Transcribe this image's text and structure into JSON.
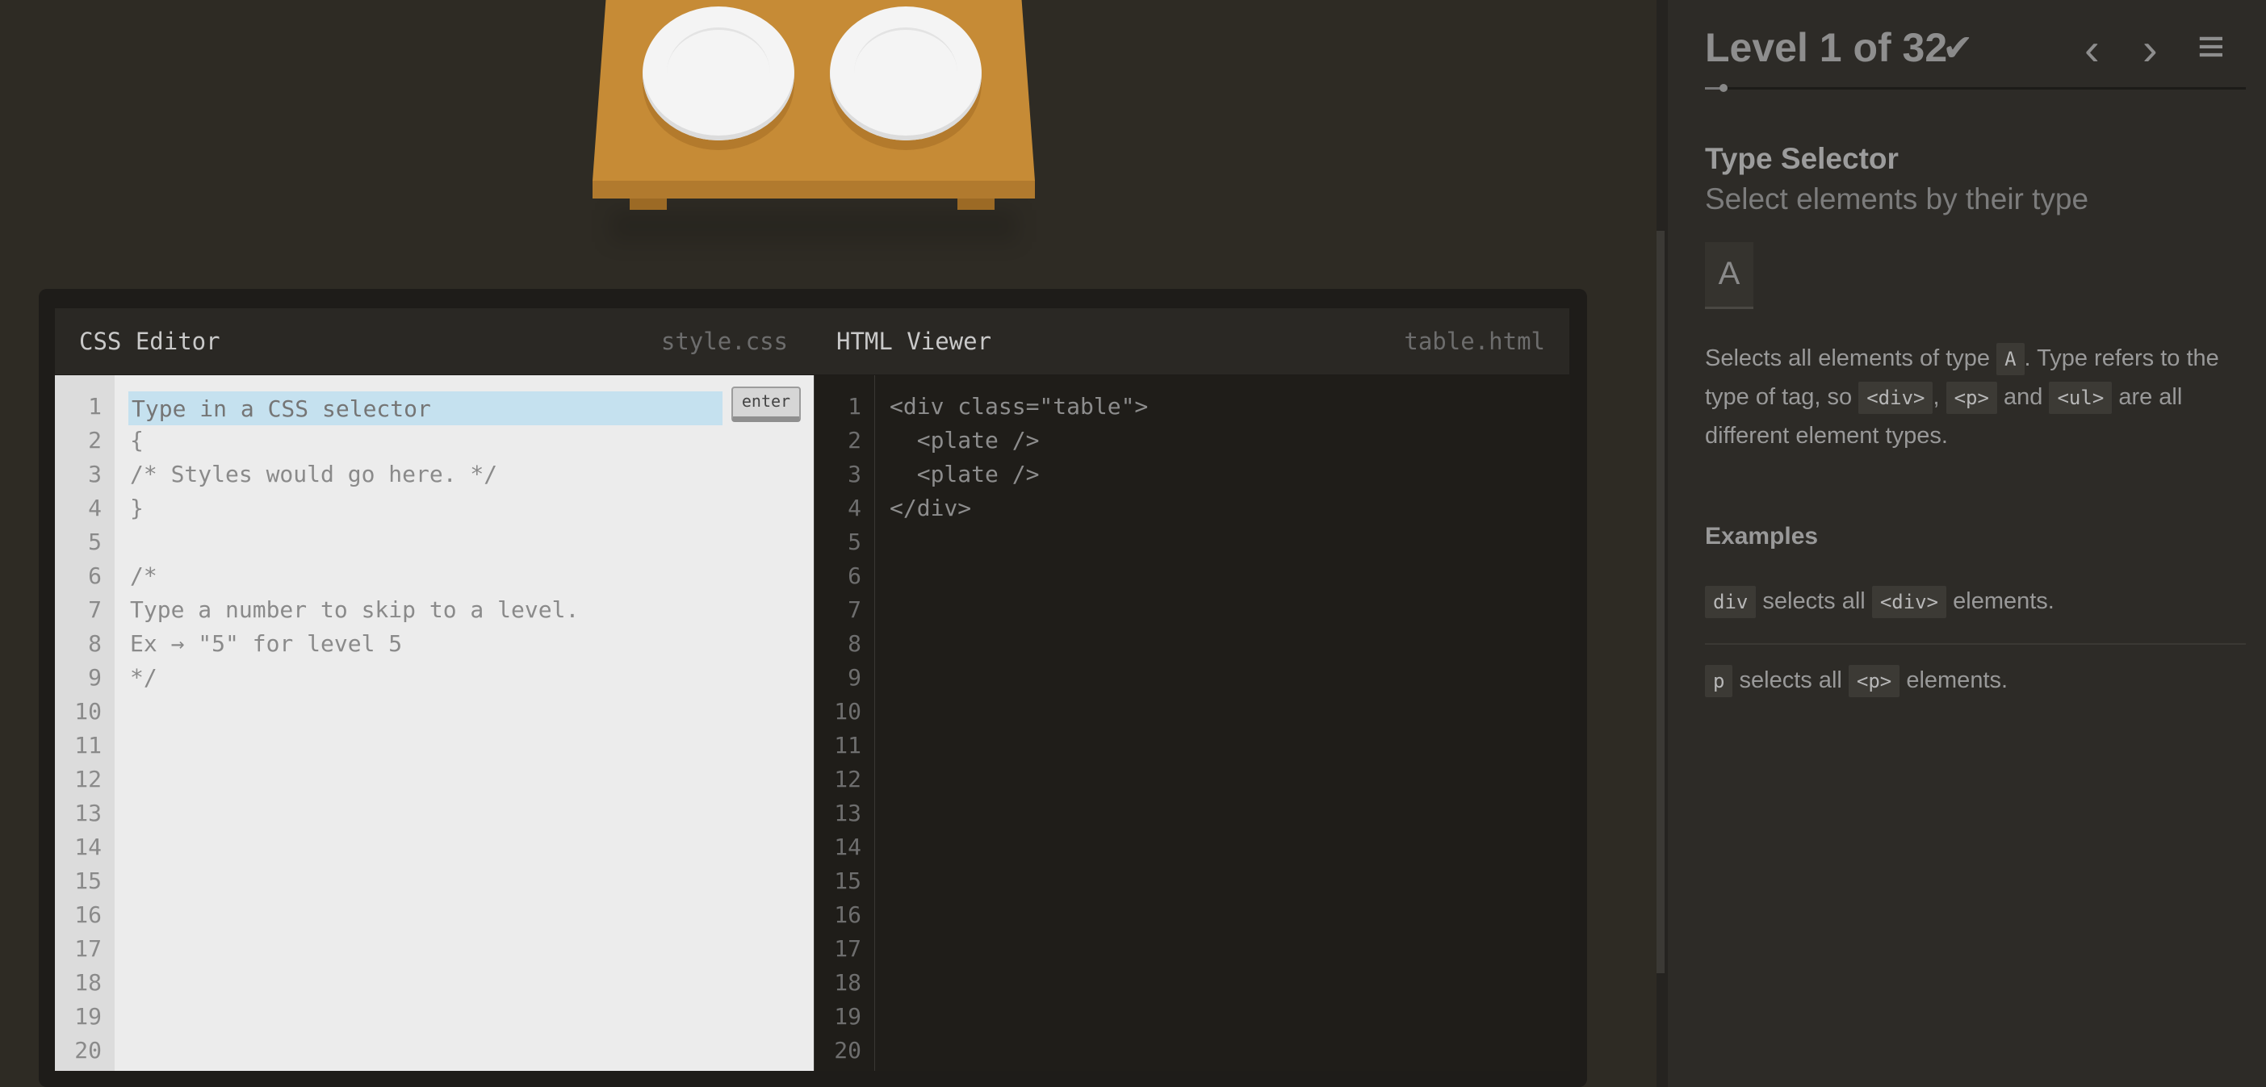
{
  "game": {
    "table_items": [
      {
        "name": "plate"
      },
      {
        "name": "plate"
      }
    ]
  },
  "css_editor": {
    "title": "CSS Editor",
    "filename": "style.css",
    "input_placeholder": "Type in a CSS selector",
    "enter_label": "enter",
    "lines": [
      "",
      "{",
      "/* Styles would go here. */",
      "}",
      "",
      "/*",
      "Type a number to skip to a level.",
      "Ex → \"5\" for level 5",
      "*/",
      "",
      "",
      "",
      "",
      "",
      "",
      "",
      "",
      "",
      "",
      ""
    ],
    "line_numbers": [
      "1",
      "2",
      "3",
      "4",
      "5",
      "6",
      "7",
      "8",
      "9",
      "10",
      "11",
      "12",
      "13",
      "14",
      "15",
      "16",
      "17",
      "18",
      "19",
      "20"
    ]
  },
  "html_viewer": {
    "title": "HTML Viewer",
    "filename": "table.html",
    "lines": [
      "<div class=\"table\">",
      "  <plate />",
      "  <plate />",
      "</div>",
      "",
      "",
      "",
      "",
      "",
      "",
      "",
      "",
      "",
      "",
      "",
      "",
      "",
      "",
      "",
      ""
    ],
    "line_numbers": [
      "1",
      "2",
      "3",
      "4",
      "5",
      "6",
      "7",
      "8",
      "9",
      "10",
      "11",
      "12",
      "13",
      "14",
      "15",
      "16",
      "17",
      "18",
      "19",
      "20"
    ]
  },
  "sidebar": {
    "level_title": "Level 1 of 32",
    "check_icon": "✔",
    "prev_icon": "‹",
    "next_icon": "›",
    "menu_icon": "≡",
    "progress": 0.03125,
    "selector_name": "Type Selector",
    "selector_title": "Select elements by their type",
    "syntax": "A",
    "hint": {
      "t1": "Selects all elements of type ",
      "tag_a": "A",
      "t2": ". Type refers to the type of tag, so ",
      "tag_div": "<div>",
      "t3": ", ",
      "tag_p": "<p>",
      "t4": " and ",
      "tag_ul": "<ul>",
      "t5": " are all different element types."
    },
    "examples_heading": "Examples",
    "examples": [
      {
        "code": "div",
        "text1": "selects all",
        "tag": "<div>",
        "text2": "elements."
      },
      {
        "code": "p",
        "text1": "selects all",
        "tag": "<p>",
        "text2": "elements."
      }
    ]
  }
}
